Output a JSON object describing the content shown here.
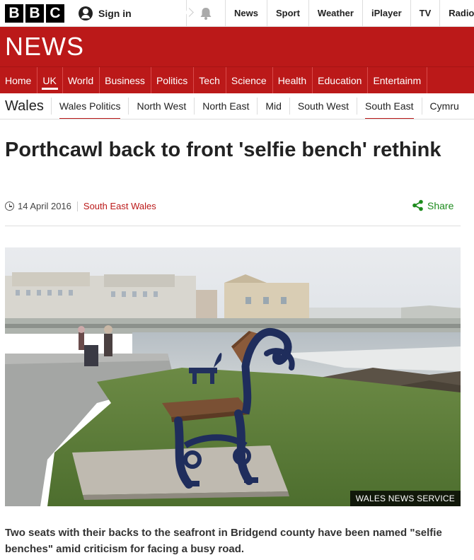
{
  "brand": {
    "letters": [
      "B",
      "B",
      "C"
    ],
    "wordmark": "NEWS"
  },
  "account": {
    "signin_label": "Sign in"
  },
  "topnav": [
    "News",
    "Sport",
    "Weather",
    "iPlayer",
    "TV",
    "Radio"
  ],
  "mainnav": [
    "Home",
    "UK",
    "World",
    "Business",
    "Politics",
    "Tech",
    "Science",
    "Health",
    "Education",
    "Entertainm"
  ],
  "mainnav_active": "UK",
  "subnav": {
    "section": "Wales",
    "items": [
      "Wales Politics",
      "North West",
      "North East",
      "Mid",
      "South West",
      "South East",
      "Cymru"
    ]
  },
  "article": {
    "headline": "Porthcawl back to front 'selfie bench' rethink",
    "date": "14 April 2016",
    "section_link": "South East Wales",
    "share_label": "Share",
    "photo_credit": "WALES NEWS SERVICE",
    "summary": "Two seats with their backs to the seafront in Bridgend county have been named \"selfie benches\" amid criticism for facing a busy road."
  },
  "colors": {
    "brand_red": "#bb1919",
    "share_green": "#1d8b1d",
    "bench_blue": "#1f2d5c"
  },
  "icons": [
    "user-icon",
    "bell-icon",
    "clock-icon",
    "share-icon"
  ]
}
